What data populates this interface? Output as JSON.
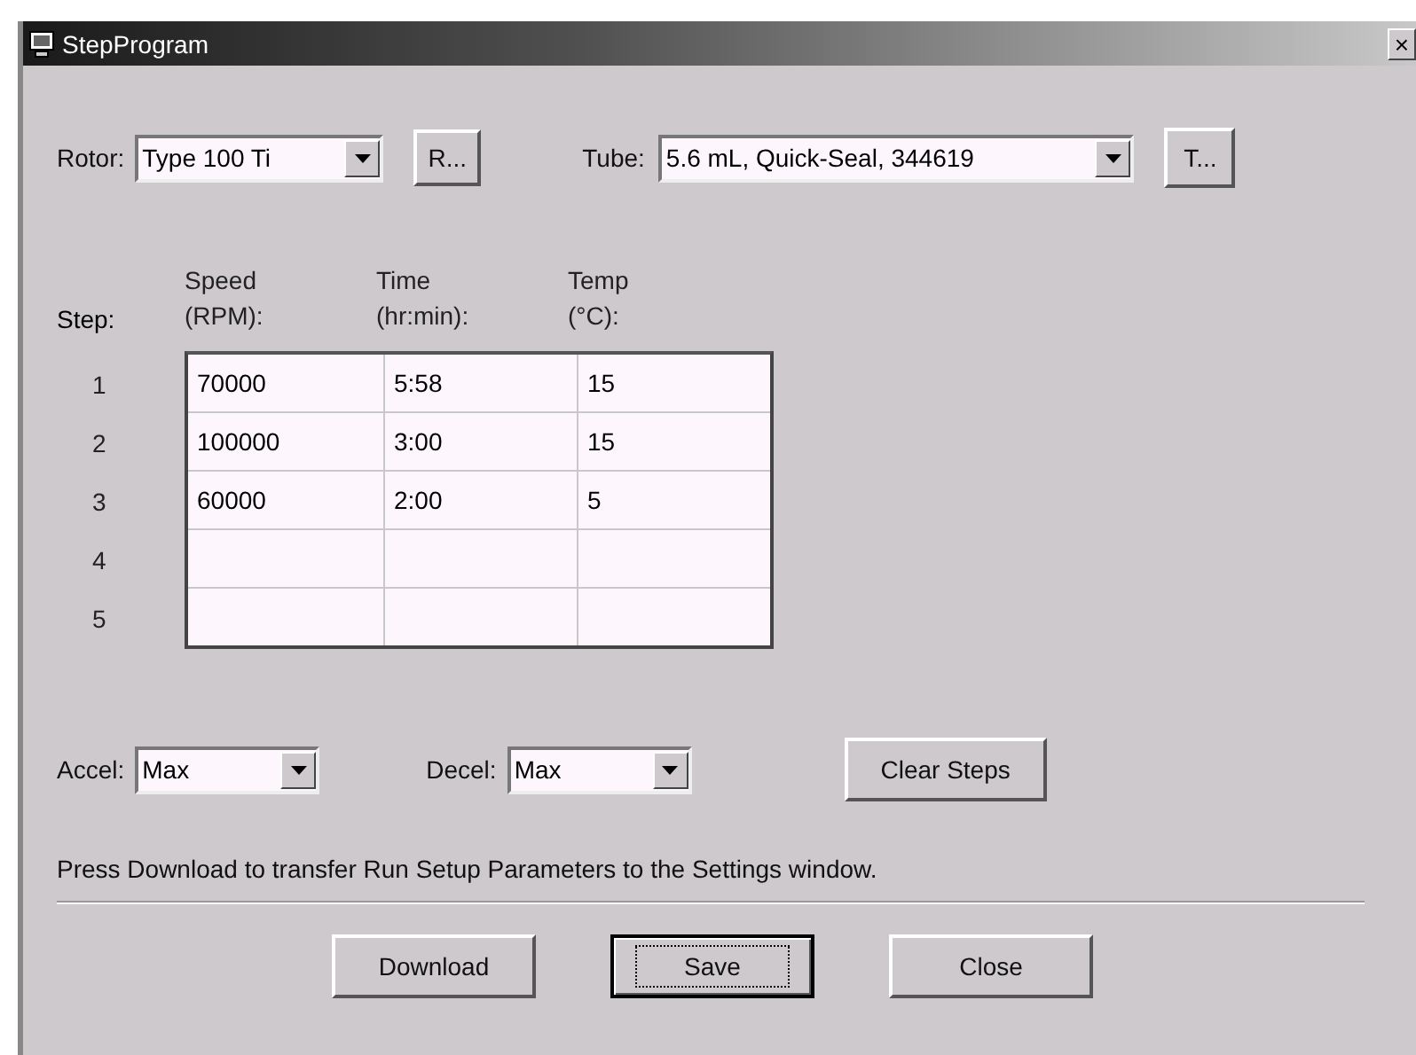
{
  "window": {
    "title": "StepProgram",
    "close": "×"
  },
  "rotor": {
    "label": "Rotor:",
    "value": "Type 100 Ti",
    "button": "R..."
  },
  "tube": {
    "label": "Tube:",
    "value": "5.6 mL, Quick-Seal, 344619",
    "button": "T..."
  },
  "steps": {
    "step_label": "Step:",
    "columns": [
      {
        "line1": "Speed",
        "line2": "(RPM):"
      },
      {
        "line1": "Time",
        "line2": "(hr:min):"
      },
      {
        "line1": "Temp",
        "line2": "(°C):"
      }
    ],
    "rows": [
      {
        "step": "1",
        "cells": [
          "70000",
          "5:58",
          "15"
        ]
      },
      {
        "step": "2",
        "cells": [
          "100000",
          "3:00",
          "15"
        ]
      },
      {
        "step": "3",
        "cells": [
          "60000",
          "2:00",
          "5"
        ]
      },
      {
        "step": "4",
        "cells": []
      },
      {
        "step": "5",
        "cells": []
      }
    ]
  },
  "accel": {
    "label": "Accel:",
    "value": "Max"
  },
  "decel": {
    "label": "Decel:",
    "value": "Max"
  },
  "clear_button": "Clear Steps",
  "message": "Press Download to transfer Run Setup Parameters to the Settings window.",
  "buttons": [
    {
      "label": "Download",
      "focused": false
    },
    {
      "label": "Save",
      "focused": true
    },
    {
      "label": "Close",
      "focused": false
    }
  ]
}
